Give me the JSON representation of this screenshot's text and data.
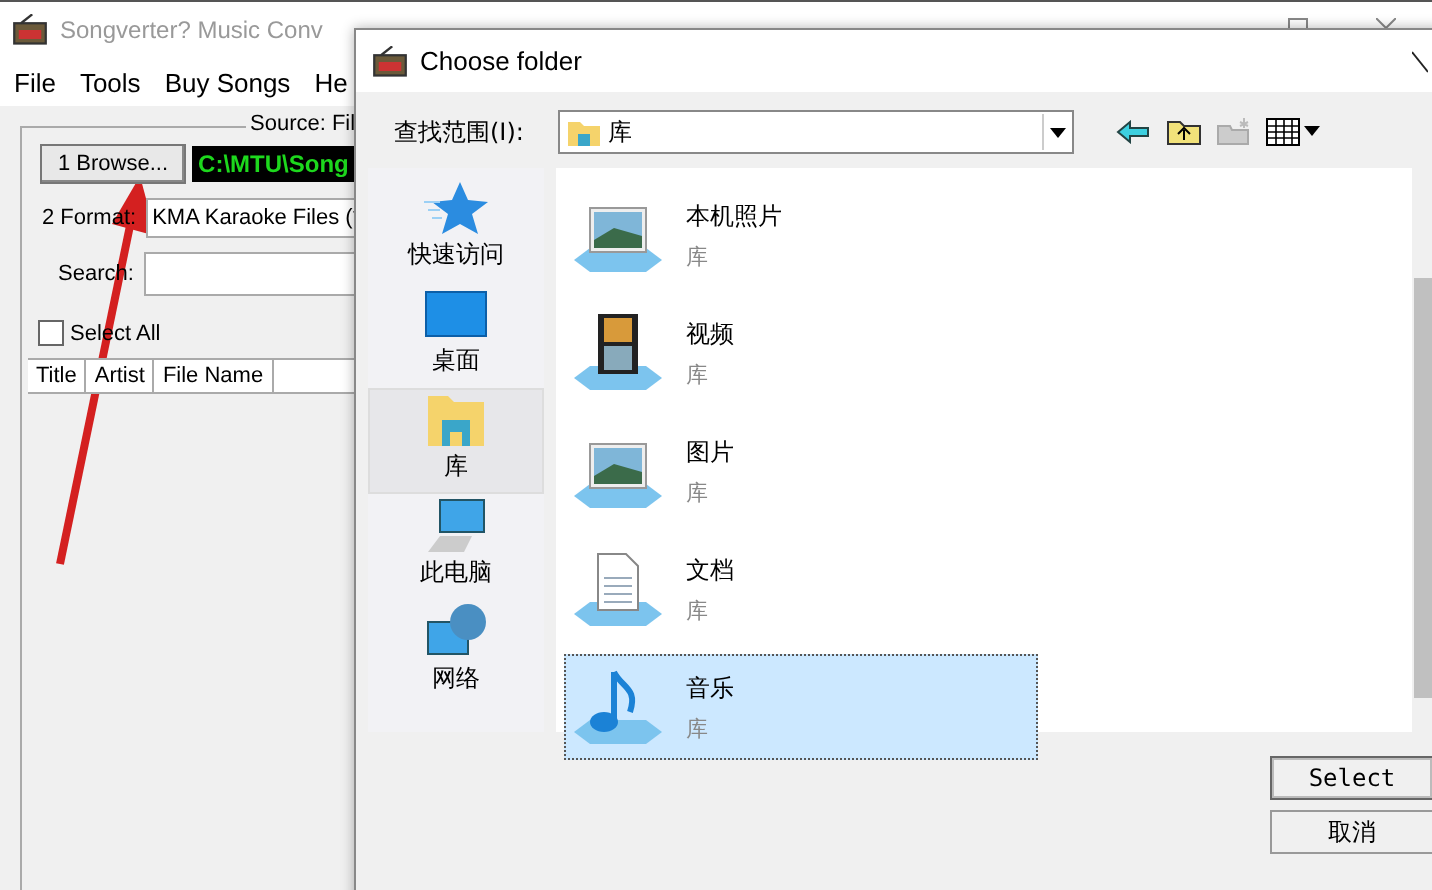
{
  "main_window": {
    "title": "Songverter? Music Conv",
    "menu": [
      "File",
      "Tools",
      "Buy Songs",
      "He"
    ],
    "source_legend": "Source: Fil",
    "browse_button": "1 Browse...",
    "path": "C:\\MTU\\Song",
    "format_label": "2 Format:",
    "format_value": "KMA Karaoke Files (*",
    "search_label": "Search:",
    "select_all": {
      "label": "Select All",
      "checked": false
    },
    "columns": [
      "Title",
      "Artist",
      "File Name"
    ]
  },
  "dialog": {
    "title": "Choose folder",
    "look_in_label": "查找范围(I):",
    "look_in_value": "库",
    "places": [
      {
        "label": "快速访问",
        "selected": false
      },
      {
        "label": "桌面",
        "selected": false
      },
      {
        "label": "库",
        "selected": true
      },
      {
        "label": "此电脑",
        "selected": false
      },
      {
        "label": "网络",
        "selected": false
      }
    ],
    "items": [
      {
        "name": "本机照片",
        "type": "库",
        "kind": "photos",
        "selected": false
      },
      {
        "name": "视频",
        "type": "库",
        "kind": "video",
        "selected": false
      },
      {
        "name": "图片",
        "type": "库",
        "kind": "photos",
        "selected": false
      },
      {
        "name": "文档",
        "type": "库",
        "kind": "document",
        "selected": false
      },
      {
        "name": "音乐",
        "type": "库",
        "kind": "music",
        "selected": true
      }
    ],
    "buttons": [
      "Select",
      "取消"
    ]
  }
}
